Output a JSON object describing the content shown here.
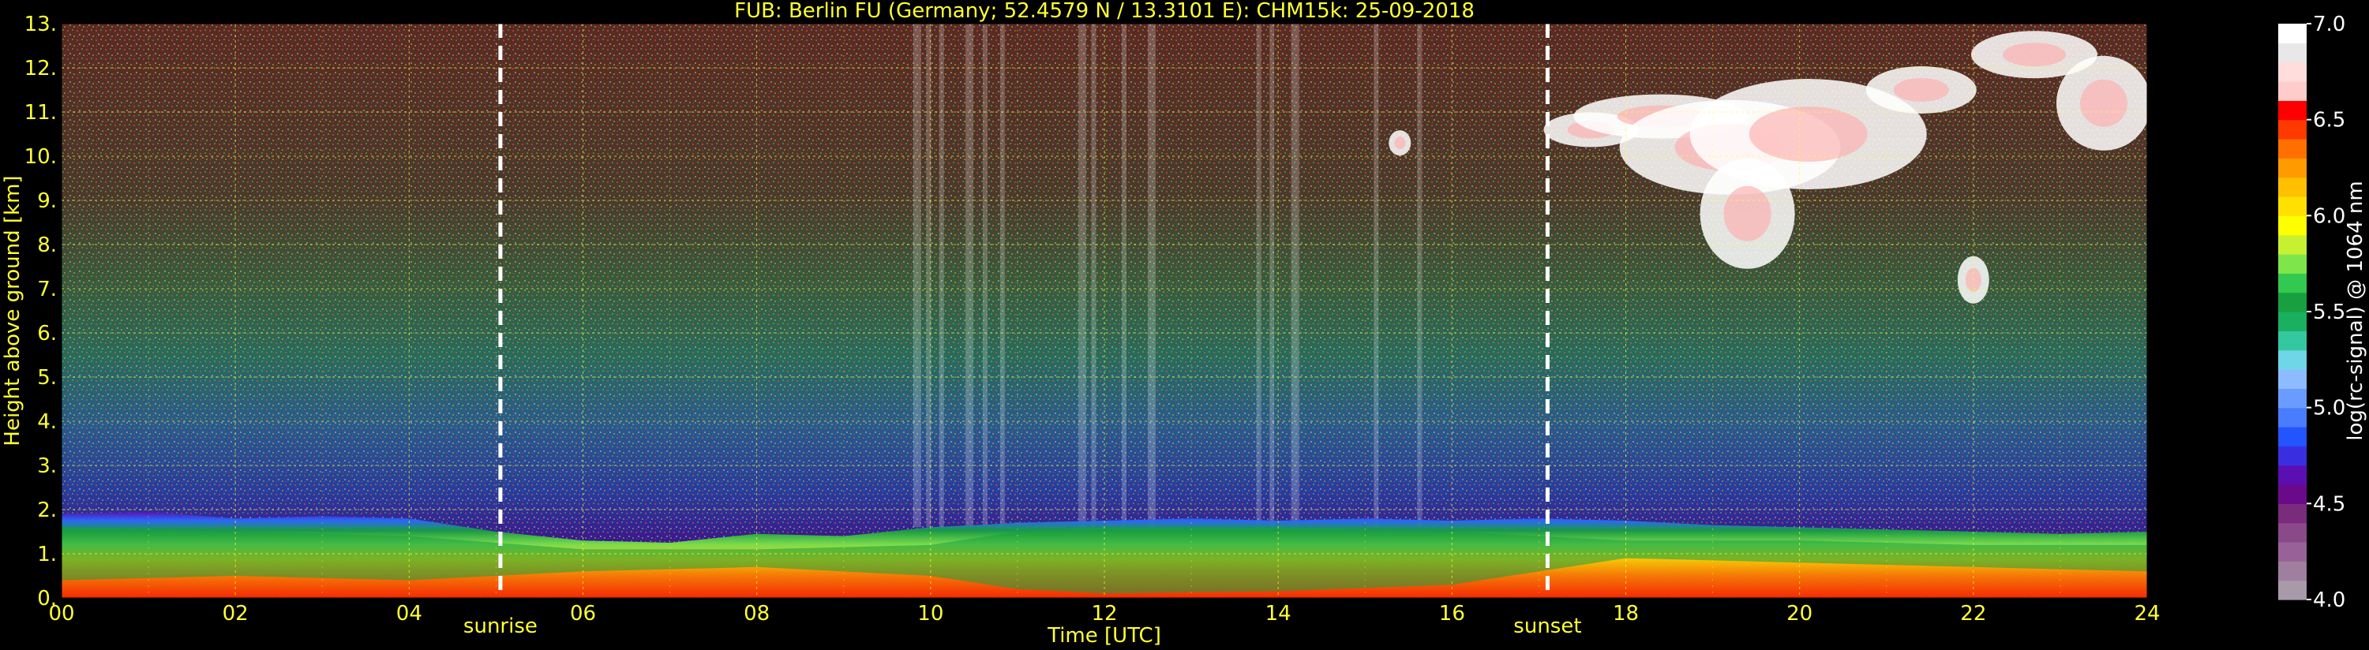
{
  "title": "FUB: Berlin FU (Germany; 52.4579 N / 13.3101 E):    CHM15k: 25-09-2018",
  "chart_data": {
    "type": "heatmap",
    "title": "FUB: Berlin FU (Germany; 52.4579 N / 13.3101 E):    CHM15k: 25-09-2018",
    "xlabel": "Time [UTC]",
    "ylabel": "Height above ground [km]",
    "xlim": [
      0,
      24
    ],
    "ylim": [
      0,
      13
    ],
    "x_ticks": [
      0,
      2,
      4,
      6,
      8,
      10,
      12,
      14,
      16,
      18,
      20,
      22,
      24
    ],
    "x_tick_labels": [
      "00",
      "02",
      "04",
      "06",
      "08",
      "10",
      "12",
      "14",
      "16",
      "18",
      "20",
      "22",
      "24"
    ],
    "y_ticks": [
      0,
      1,
      2,
      3,
      4,
      5,
      6,
      7,
      8,
      9,
      10,
      11,
      12,
      13
    ],
    "y_tick_labels": [
      "0.",
      "1.",
      "2.",
      "3.",
      "4.",
      "5.",
      "6.",
      "7.",
      "8.",
      "9.",
      "10.",
      "11.",
      "12.",
      "13."
    ],
    "grid": true,
    "colorbar": {
      "label": "log(rc-signal) @ 1064 nm",
      "range": [
        4.0,
        7.0
      ],
      "ticks": [
        4.0,
        4.5,
        5.0,
        5.5,
        6.0,
        6.5,
        7.0
      ],
      "tick_labels": [
        "4.0",
        "4.5",
        "5.0",
        "5.5",
        "6.0",
        "6.5",
        "7.0"
      ],
      "colors": [
        "#a89aa8",
        "#a07ea0",
        "#986298",
        "#8a4a8a",
        "#7a2c7c",
        "#6a0a8a",
        "#5b0fb2",
        "#3a2fe0",
        "#2255ff",
        "#4a7cff",
        "#6a9cff",
        "#8cbcff",
        "#6ed6e6",
        "#33c8a0",
        "#1ab060",
        "#18a040",
        "#33c850",
        "#7ee64a",
        "#c8f032",
        "#ffff00",
        "#ffe000",
        "#ffc000",
        "#ff9a00",
        "#ff7000",
        "#ff3a00",
        "#ff0000",
        "#ffcccc",
        "#ffdddd",
        "#e8e8e8",
        "#ffffff"
      ]
    },
    "events": [
      {
        "label": "sunrise",
        "time": 5.05
      },
      {
        "label": "sunset",
        "time": 17.1
      }
    ]
  }
}
